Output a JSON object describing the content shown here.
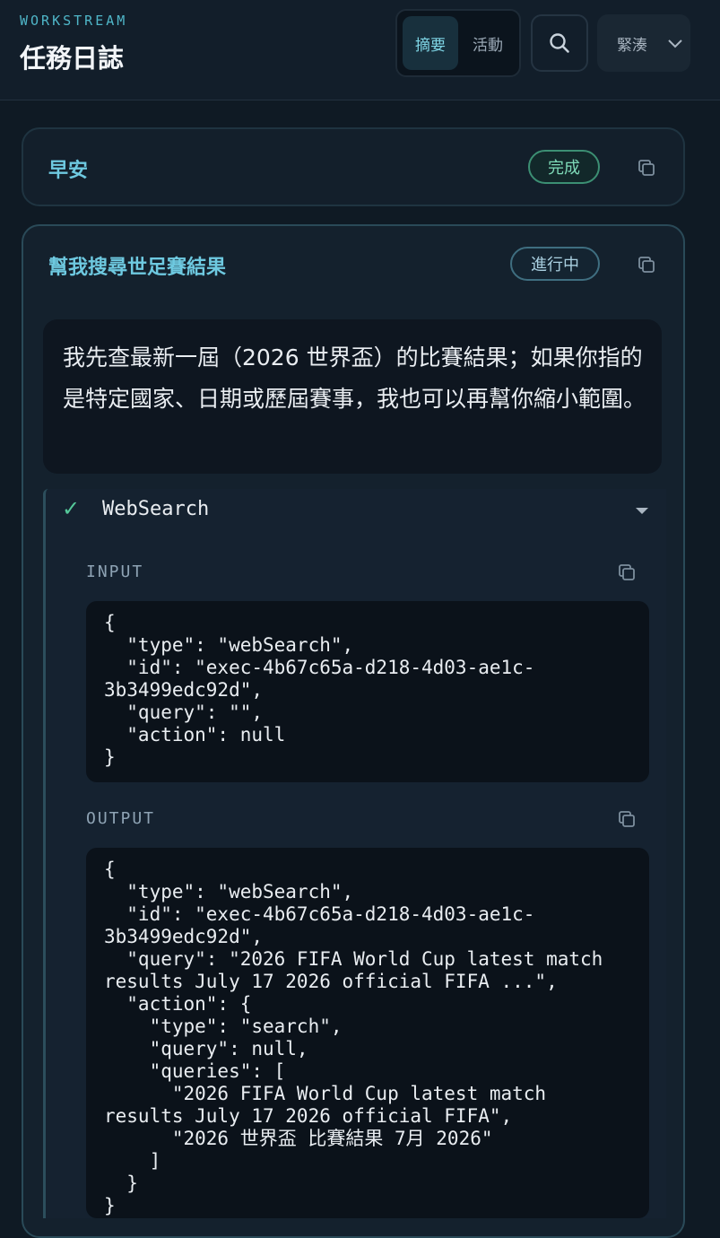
{
  "header": {
    "eyebrow": "WORKSTREAM",
    "title": "任務日誌",
    "tabs": [
      {
        "label": "摘要",
        "active": true
      },
      {
        "label": "活動",
        "active": false
      }
    ],
    "search_icon": "search-icon",
    "density_select": {
      "value": "緊湊",
      "icon": "chevron-down-icon"
    }
  },
  "cards": [
    {
      "title": "早安",
      "status": "完成",
      "status_color": "#7edab8",
      "copy_icon": "copy-icon"
    },
    {
      "title": "幫我搜尋世足賽結果",
      "status": "進行中",
      "status_color": "#a9cfe0",
      "copy_icon": "copy-icon",
      "message": "我先查最新一屆（2026 世界盃）的比賽結果；如果你指的是特定國家、日期或歷屆賽事，我也可以再幫你縮小範圍。",
      "tool": {
        "status_icon": "check-icon",
        "name": "WebSearch",
        "input_label": "INPUT",
        "input_code": "{\n  \"type\": \"webSearch\",\n  \"id\": \"exec-4b67c65a-d218-4d03-ae1c-\n3b3499edc92d\",\n  \"query\": \"\",\n  \"action\": null\n}",
        "output_label": "OUTPUT",
        "output_code": "{\n  \"type\": \"webSearch\",\n  \"id\": \"exec-4b67c65a-d218-4d03-ae1c-\n3b3499edc92d\",\n  \"query\": \"2026 FIFA World Cup latest match\nresults July 17 2026 official FIFA ...\",\n  \"action\": {\n    \"type\": \"search\",\n    \"query\": null,\n    \"queries\": [\n      \"2026 FIFA World Cup latest match\nresults July 17 2026 official FIFA\",\n      \"2026 世界盃 比賽結果 7月 2026\"\n    ]\n  }\n}"
      }
    }
  ],
  "colors": {
    "accent": "#6ec9e0",
    "background": "#0f1a24",
    "success": "#55c99a"
  }
}
